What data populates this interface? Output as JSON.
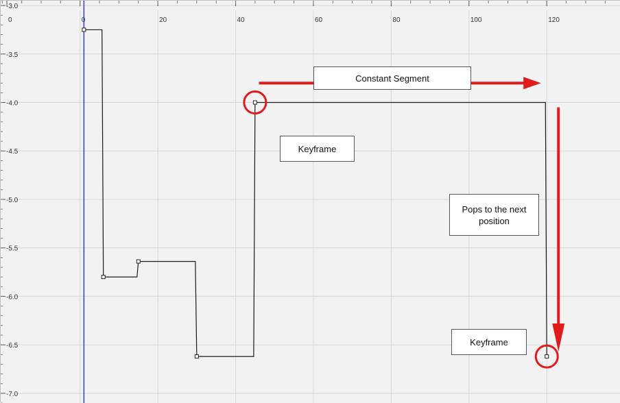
{
  "chart_data": {
    "type": "line",
    "interpolation": "constant",
    "x_ticks": [
      "0",
      "0",
      "20",
      "40",
      "60",
      "80",
      "100",
      "120"
    ],
    "y_ticks": [
      "-3.0",
      "-3.5",
      "-4.0",
      "-4.5",
      "-5.0",
      "-5.5",
      "-6.0",
      "-6.5",
      "-7.0"
    ],
    "xlim": [
      -20.4,
      139
    ],
    "ylim": [
      -7.1,
      -2.95
    ],
    "grid": true,
    "current_frame": 1,
    "series": [
      {
        "points": [
          {
            "x": 1,
            "y": -3.25
          },
          {
            "x": 6,
            "y": -5.8
          },
          {
            "x": 15,
            "y": -5.64
          },
          {
            "x": 30,
            "y": -6.62
          },
          {
            "x": 45,
            "y": -4.0
          },
          {
            "x": 120,
            "y": -6.62
          }
        ]
      }
    ],
    "annotations": [
      {
        "text": "Constant Segment"
      },
      {
        "text": "Keyframe"
      },
      {
        "text": "Pops to the next position"
      },
      {
        "text": "Keyframe"
      }
    ],
    "colors": {
      "background": "#f2f2f2",
      "grid": "#d6d6d6",
      "curve": "#1a1a1a",
      "current_frame_line": "#3a3ad0",
      "annotation": "#e11b1b"
    }
  }
}
